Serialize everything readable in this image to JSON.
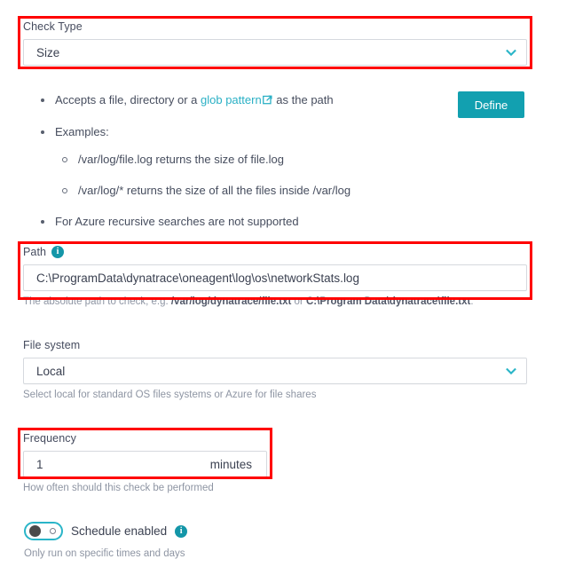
{
  "check_type": {
    "label": "Check Type",
    "value": "Size",
    "chevron_icon": "chevron-down-icon"
  },
  "description": {
    "items": [
      {
        "text_before": "Accepts a file, directory or a ",
        "link_text": "glob pattern",
        "link_icon": "external-link-icon",
        "text_after": " as the path"
      },
      {
        "text_before": "Examples:",
        "sub_items": [
          "/var/log/file.log returns the size of file.log",
          "/var/log/* returns the size of all the files inside /var/log"
        ]
      },
      {
        "text_before": "For Azure recursive searches are not supported"
      }
    ]
  },
  "define_button": {
    "label": "Define"
  },
  "path": {
    "label": "Path",
    "info_icon": "info-icon",
    "info_glyph": "i",
    "value": "C:\\ProgramData\\dynatrace\\oneagent\\log\\os\\networkStats.log",
    "placeholder": "",
    "hint_prefix": "The absolute path to check, e.g. ",
    "hint_bold_1": "/var/log/dynatrace/file.txt",
    "hint_middle": " or ",
    "hint_bold_2": "C:\\Program Data\\dynatrace\\file.txt",
    "hint_suffix": "."
  },
  "file_system": {
    "label": "File system",
    "value": "Local",
    "chevron_icon": "chevron-down-icon",
    "hint": "Select local for standard OS files systems or Azure for file shares"
  },
  "frequency": {
    "label": "Frequency",
    "value": "1",
    "placeholder": "",
    "unit": "minutes",
    "hint": "How often should this check be performed"
  },
  "schedule": {
    "label": "Schedule enabled",
    "info_icon": "info-icon",
    "info_glyph": "i",
    "state": "off",
    "hint": "Only run on specific times and days"
  },
  "colors": {
    "accent": "#12a0b0",
    "link": "#2ab0c5",
    "annotation": "#ff0000",
    "text": "#3b4151",
    "hint_text": "#8e95a3"
  }
}
